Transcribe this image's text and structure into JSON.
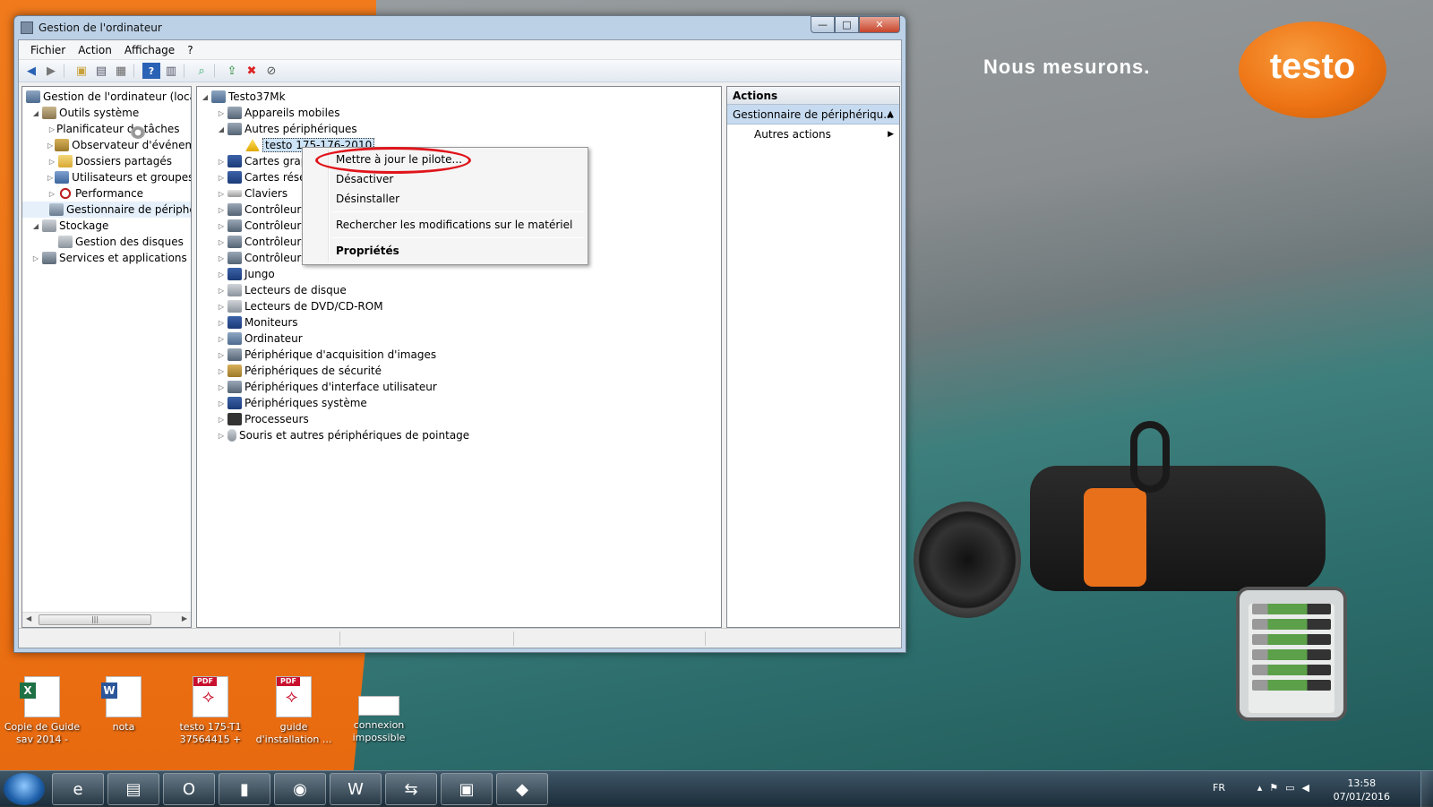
{
  "window": {
    "title": "Gestion de l'ordinateur",
    "controls": {
      "minimize": "—",
      "maximize": "□",
      "close": "✕"
    }
  },
  "menu": [
    "Fichier",
    "Action",
    "Affichage",
    "?"
  ],
  "toolbar": {
    "icons": [
      "back-icon",
      "forward-icon",
      "up-folder-icon",
      "show-hide-tree-icon",
      "properties-icon",
      "help-icon",
      "show-hide-action-pane-icon",
      "scan-hardware-icon",
      "update-driver-icon",
      "uninstall-icon",
      "disable-icon"
    ]
  },
  "left_tree": {
    "root": "Gestion de l'ordinateur (local)",
    "system_tools": "Outils système",
    "items": [
      "Planificateur de tâches",
      "Observateur d'événeme",
      "Dossiers partagés",
      "Utilisateurs et groupes l",
      "Performance",
      "Gestionnaire de périphé"
    ],
    "storage": "Stockage",
    "storage_items": [
      "Gestion des disques"
    ],
    "services": "Services et applications"
  },
  "device_tree": {
    "root": "Testo37Mk",
    "mobile": "Appareils mobiles",
    "other": "Autres périphériques",
    "device": "testo 175-176-2010",
    "categories": [
      "Cartes grap",
      "Cartes résea",
      "Claviers",
      "Contrôleurs",
      "Contrôleurs",
      "Contrôleurs",
      "Contrôleurs",
      "Jungo",
      "Lecteurs de disque",
      "Lecteurs de DVD/CD-ROM",
      "Moniteurs",
      "Ordinateur",
      "Périphérique d'acquisition d'images",
      "Périphériques de sécurité",
      "Périphériques d'interface utilisateur",
      "Périphériques système",
      "Processeurs",
      "Souris et autres périphériques de pointage"
    ]
  },
  "actions": {
    "header": "Actions",
    "section": "Gestionnaire de périphériqu...",
    "more": "Autres actions"
  },
  "context_menu": {
    "update_driver": "Mettre à jour le pilote...",
    "disable": "Désactiver",
    "uninstall": "Désinstaller",
    "scan": "Rechercher les modifications sur le matériel",
    "properties": "Propriétés"
  },
  "desktop": {
    "slogan": "Nous mesurons.",
    "logo": "testo",
    "icons": [
      {
        "label": "Copie de Guide sav 2014 -",
        "type": "excel-file-icon"
      },
      {
        "label": "nota",
        "type": "word-file-icon"
      },
      {
        "label": "testo 175-T1 37564415 +",
        "type": "pdf-file-icon"
      },
      {
        "label": "guide d'installation ...",
        "type": "pdf-file-icon"
      },
      {
        "label": "connexion impossible",
        "type": "image-file-icon"
      }
    ]
  },
  "taskbar": {
    "apps": [
      "internet-explorer-icon",
      "file-explorer-icon",
      "outlook-icon",
      "usb-tool-icon",
      "chrome-icon",
      "word-icon",
      "teamviewer-icon",
      "computer-management-icon",
      "network-icon"
    ],
    "language": "FR",
    "time": "13:58",
    "date": "07/01/2016"
  },
  "colors": {
    "accent_orange": "#ee7414",
    "selection": "#cde4f7",
    "highlight_circle": "#e0151b"
  }
}
